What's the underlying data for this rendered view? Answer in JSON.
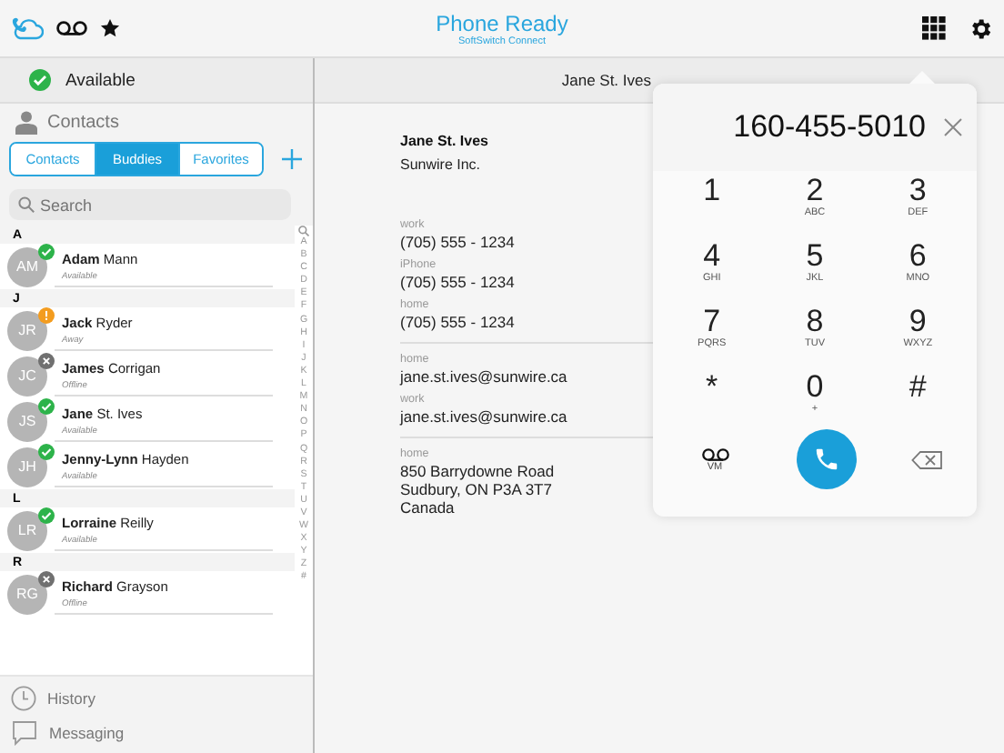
{
  "top_bar": {
    "title": "Phone Ready",
    "subtitle": "SoftSwitch Connect"
  },
  "my_status": {
    "label": "Available",
    "kind": "available"
  },
  "contacts_panel": {
    "heading": "Contacts",
    "tabs": [
      {
        "label": "Contacts",
        "selected": false
      },
      {
        "label": "Buddies",
        "selected": true
      },
      {
        "label": "Favorites",
        "selected": false
      }
    ],
    "search": {
      "placeholder": "Search"
    },
    "groups": [
      {
        "letter": "A",
        "contacts": [
          {
            "initials": "AM",
            "name": "**Adam** Mann",
            "status": "Available",
            "kind": "available",
            "selected": false
          }
        ]
      },
      {
        "letter": "J",
        "contacts": [
          {
            "initials": "JR",
            "name": "**Jack** Ryder",
            "status": "Away",
            "kind": "away",
            "selected": false
          },
          {
            "initials": "JC",
            "name": "**James** Corrigan",
            "status": "Offline",
            "kind": "offline",
            "selected": false
          },
          {
            "initials": "JS",
            "name": "**Jane** St. Ives",
            "status": "Available",
            "kind": "available",
            "selected": false
          },
          {
            "initials": "JH",
            "name": "**Jenny-Lynn** Hayden",
            "status": "Available",
            "kind": "available",
            "selected": false
          }
        ]
      },
      {
        "letter": "L",
        "contacts": [
          {
            "initials": "LR",
            "name": "**Lorraine** Reilly",
            "status": "Available",
            "kind": "available",
            "selected": false
          }
        ]
      },
      {
        "letter": "R",
        "contacts": [
          {
            "initials": "RG",
            "name": "**Richard** Grayson",
            "status": "Offline",
            "kind": "offline",
            "selected": false
          }
        ]
      }
    ],
    "index_letters": [
      "A",
      "B",
      "C",
      "D",
      "E",
      "F",
      "G",
      "H",
      "I",
      "J",
      "K",
      "L",
      "M",
      "N",
      "O",
      "P",
      "Q",
      "R",
      "S",
      "T",
      "U",
      "V",
      "W",
      "X",
      "Y",
      "Z",
      "#"
    ]
  },
  "bottom_nav": [
    {
      "label": "History",
      "kind": "history"
    },
    {
      "label": "Messaging",
      "kind": "messaging"
    }
  ],
  "detail": {
    "header": "Jane St. Ives",
    "name": "Jane St. Ives",
    "company": "Sunwire Inc.",
    "sections": [
      {
        "fields": [
          {
            "label": "work",
            "value": "(705) 555 - 1234"
          },
          {
            "label": "iPhone",
            "value": "(705) 555 - 1234"
          },
          {
            "label": "home",
            "value": "(705) 555 - 1234"
          }
        ]
      },
      {
        "fields": [
          {
            "label": "home",
            "value": "jane.st.ives@sunwire.ca"
          },
          {
            "label": "work",
            "value": "jane.st.ives@sunwire.ca"
          }
        ]
      },
      {
        "fields": [
          {
            "label": "home",
            "value": "850 Barrydowne Road\nSudbury, ON  P3A 3T7\nCanada"
          }
        ]
      }
    ]
  },
  "dialer": {
    "number": "160-455-5010",
    "keys": [
      {
        "digit": "1"
      },
      {
        "digit": "2",
        "letters": "ABC"
      },
      {
        "digit": "3",
        "letters": "DEF"
      },
      {
        "digit": "4",
        "letters": "GHI"
      },
      {
        "digit": "5",
        "letters": "JKL"
      },
      {
        "digit": "6",
        "letters": "MNO"
      },
      {
        "digit": "7",
        "letters": "PQRS"
      },
      {
        "digit": "8",
        "letters": "TUV"
      },
      {
        "digit": "9",
        "letters": "WXYZ"
      },
      {
        "digit": "*"
      },
      {
        "digit": "0",
        "letters": "+"
      },
      {
        "digit": "#"
      }
    ],
    "voicemail_label": "VM"
  }
}
